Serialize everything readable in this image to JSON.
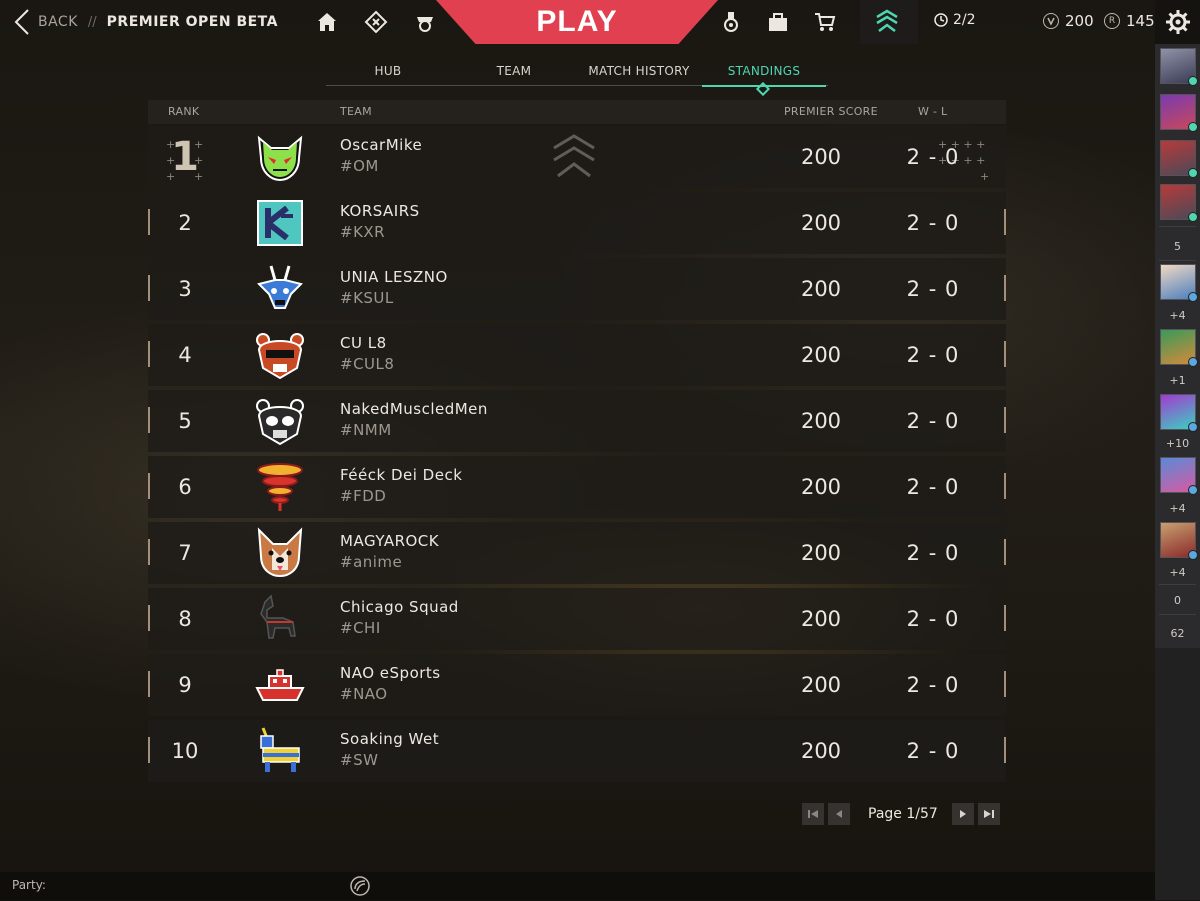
{
  "header": {
    "back_label": "BACK",
    "crumb_separator": "//",
    "title": "PREMIER OPEN BETA",
    "play_label": "PLAY",
    "queue_count": "2/2",
    "vp_amount": "200",
    "rp_amount": "145",
    "rp_icon_letter": "R"
  },
  "tabs": [
    {
      "label": "HUB"
    },
    {
      "label": "TEAM"
    },
    {
      "label": "MATCH HISTORY"
    },
    {
      "label": "STANDINGS",
      "active": true
    }
  ],
  "table": {
    "columns": {
      "rank": "RANK",
      "team": "TEAM",
      "score": "PREMIER SCORE",
      "wl": "W - L"
    },
    "rows": [
      {
        "rank": "1",
        "name": "OscarMike",
        "tag": "#OM",
        "score": "200",
        "wl": "2 - 0"
      },
      {
        "rank": "2",
        "name": "KORSAIRS",
        "tag": "#KXR",
        "score": "200",
        "wl": "2 - 0"
      },
      {
        "rank": "3",
        "name": "UNIA LESZNO",
        "tag": "#KSUL",
        "score": "200",
        "wl": "2 - 0"
      },
      {
        "rank": "4",
        "name": "CU L8",
        "tag": "#CUL8",
        "score": "200",
        "wl": "2 - 0"
      },
      {
        "rank": "5",
        "name": "NakedMuscledMen",
        "tag": "#NMM",
        "score": "200",
        "wl": "2 - 0"
      },
      {
        "rank": "6",
        "name": "Fééck Dei Deck",
        "tag": "#FDD",
        "score": "200",
        "wl": "2 - 0"
      },
      {
        "rank": "7",
        "name": "MAGYAROCK",
        "tag": "#anime",
        "score": "200",
        "wl": "2 - 0"
      },
      {
        "rank": "8",
        "name": "Chicago Squad",
        "tag": "#CHI",
        "score": "200",
        "wl": "2 - 0"
      },
      {
        "rank": "9",
        "name": "NAO eSports",
        "tag": "#NAO",
        "score": "200",
        "wl": "2 - 0"
      },
      {
        "rank": "10",
        "name": "Soaking Wet",
        "tag": "#SW",
        "score": "200",
        "wl": "2 - 0"
      }
    ]
  },
  "pagination": {
    "label": "Page 1/57"
  },
  "party": {
    "label": "Party:"
  },
  "social": {
    "count_online": "5",
    "group_counts": [
      "+4",
      "+1",
      "+10",
      "+4",
      "+4"
    ],
    "count_a": "0",
    "count_b": "62"
  },
  "colors": {
    "accent": "#4fd6b0",
    "play": "#e0404f"
  }
}
